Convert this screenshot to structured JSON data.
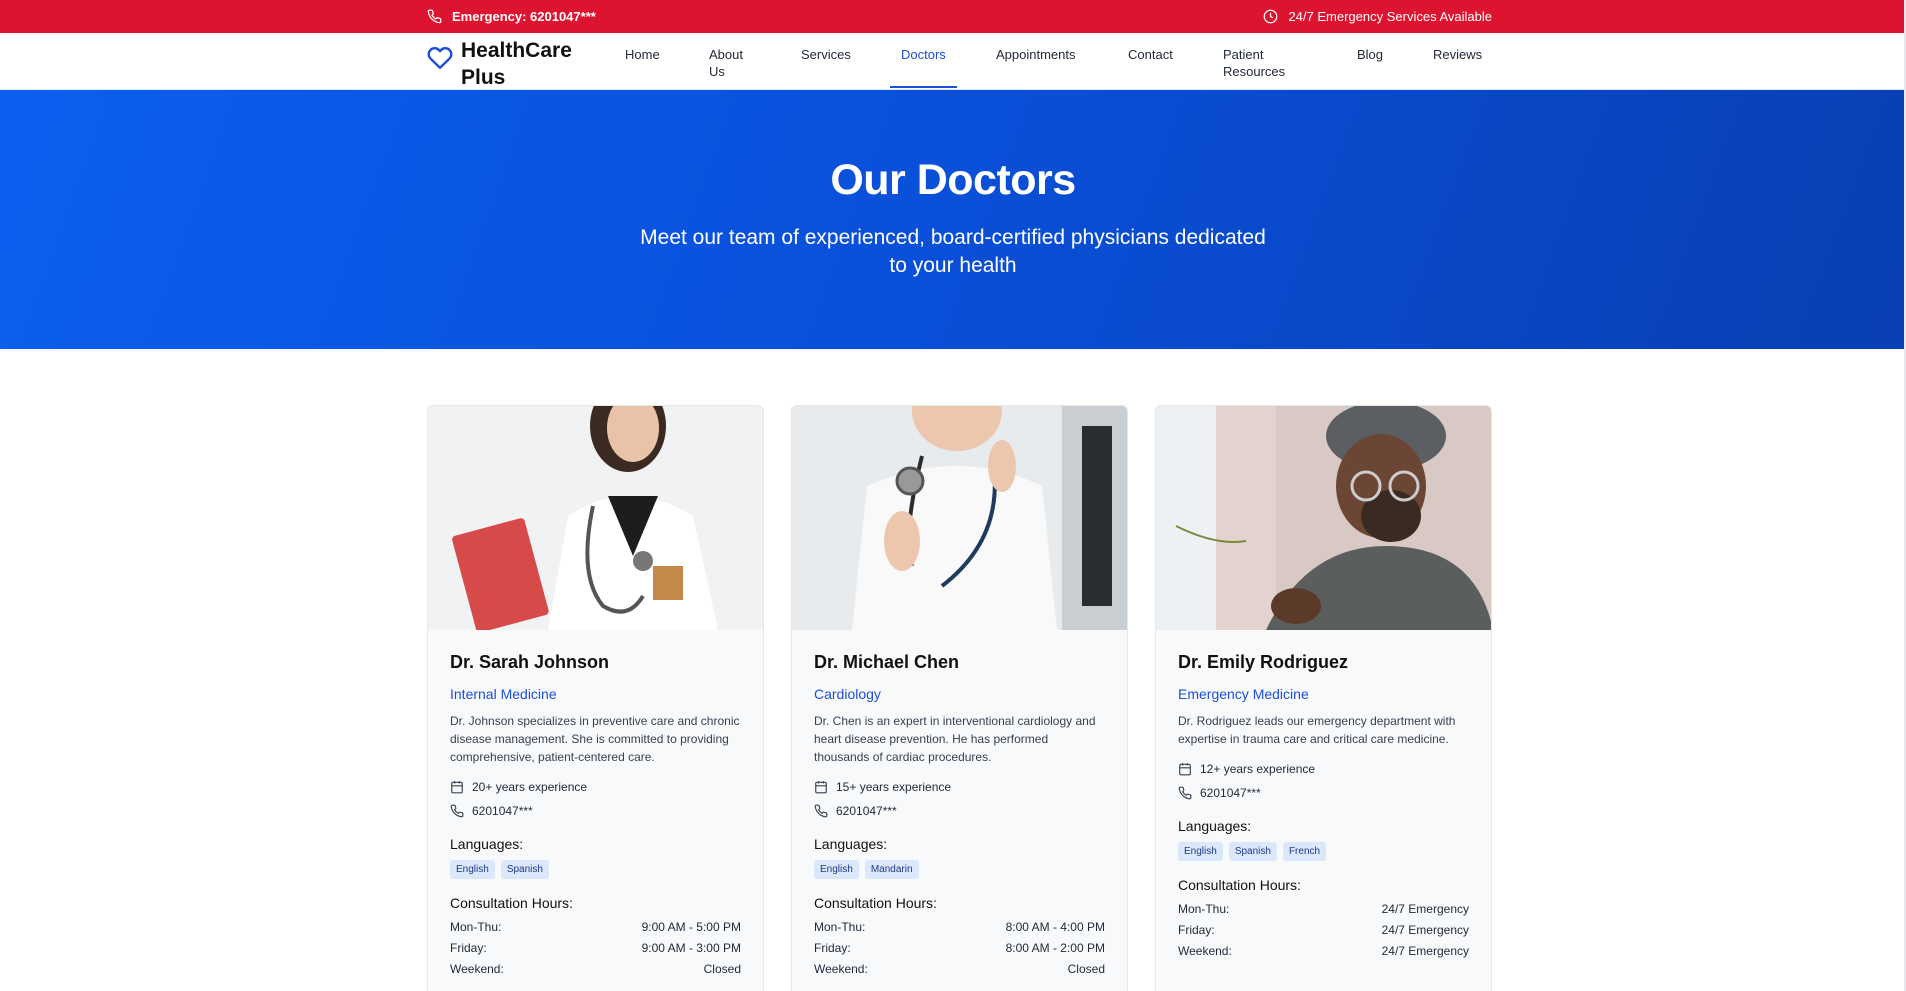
{
  "topbar": {
    "emergency": "Emergency: 6201047***",
    "availability": "24/7 Emergency Services Available"
  },
  "brand": {
    "name": "HealthCare Plus",
    "icon": "heart-icon"
  },
  "nav": {
    "items": [
      {
        "label": "Home"
      },
      {
        "label": "About Us"
      },
      {
        "label": "Services"
      },
      {
        "label": "Doctors"
      },
      {
        "label": "Appointments"
      },
      {
        "label": "Contact"
      },
      {
        "label": "Patient Resources"
      },
      {
        "label": "Blog"
      },
      {
        "label": "Reviews"
      }
    ],
    "active": "Doctors"
  },
  "hero": {
    "title": "Our Doctors",
    "subtitle": "Meet our team of experienced, board-certified physicians dedicated to your health"
  },
  "labels": {
    "languages": "Languages:",
    "hours": "Consultation Hours:"
  },
  "doctors": [
    {
      "name": "Dr. Sarah Johnson",
      "specialty": "Internal Medicine",
      "description": "Dr. Johnson specializes in preventive care and chronic disease management. She is committed to providing comprehensive, patient-centered care.",
      "experience": "20+ years experience",
      "phone": "6201047***",
      "languages": [
        "English",
        "Spanish"
      ],
      "hours": [
        {
          "day": "Mon-Thu:",
          "time": "9:00 AM - 5:00 PM"
        },
        {
          "day": "Friday:",
          "time": "9:00 AM - 3:00 PM"
        },
        {
          "day": "Weekend:",
          "time": "Closed"
        }
      ]
    },
    {
      "name": "Dr. Michael Chen",
      "specialty": "Cardiology",
      "description": "Dr. Chen is an expert in interventional cardiology and heart disease prevention. He has performed thousands of cardiac procedures.",
      "experience": "15+ years experience",
      "phone": "6201047***",
      "languages": [
        "English",
        "Mandarin"
      ],
      "hours": [
        {
          "day": "Mon-Thu:",
          "time": "8:00 AM - 4:00 PM"
        },
        {
          "day": "Friday:",
          "time": "8:00 AM - 2:00 PM"
        },
        {
          "day": "Weekend:",
          "time": "Closed"
        }
      ]
    },
    {
      "name": "Dr. Emily Rodriguez",
      "specialty": "Emergency Medicine",
      "description": "Dr. Rodriguez leads our emergency department with expertise in trauma care and critical care medicine.",
      "experience": "12+ years experience",
      "phone": "6201047***",
      "languages": [
        "English",
        "Spanish",
        "French"
      ],
      "hours": [
        {
          "day": "Mon-Thu:",
          "time": "24/7 Emergency"
        },
        {
          "day": "Friday:",
          "time": "24/7 Emergency"
        },
        {
          "day": "Weekend:",
          "time": "24/7 Emergency"
        }
      ]
    }
  ],
  "colors": {
    "topbar": "#dc1430",
    "accent": "#1d4ed8",
    "hero_start": "#0b5ff0",
    "hero_end": "#083fb3",
    "tag_bg": "#dbe7fb"
  }
}
